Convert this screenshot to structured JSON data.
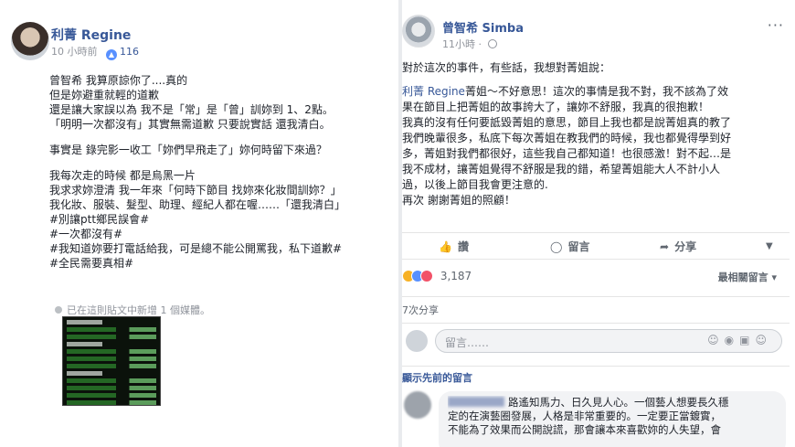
{
  "left_post": {
    "author": "利菁 Regine",
    "time": "10 小時前",
    "separator": "·",
    "like_count": "116",
    "body_lines": [
      "曾智希 我算原諒你了....真的",
      "但是妳避重就輕的道歉",
      "還是讓大家誤以為 我不是「常」是「曾」訓妳到 1、2點。",
      "「明明一次都沒有」其實無需道歉 只要說實話 還我清白。",
      "",
      "事實是 錄完影一收工「妳們早飛走了」妳何時留下來過？",
      "",
      "我每次走的時候 都是烏黑一片",
      "我求求妳澄清 我一年來「何時下節目 找妳來化妝間訓妳？」",
      "我化妝、服裝、髮型、助理、經紀人都在喔……「還我清白」",
      "#別讓ptt鄉民誤會#",
      "#一次都沒有#",
      "#我知道妳要打電話給我，可是總不能公開罵我，私下道歉#",
      "#全民需要真相#"
    ],
    "media_note": "已在這則貼文中新增 1 個媒體。"
  },
  "right_post": {
    "author": "曾智希 Simba",
    "time": "11小時",
    "separator": "·",
    "more": "···",
    "body_intro": "對於這次的事件，有些話，我想對菁姐說：",
    "mention": "利菁 Regine",
    "body_first_rest": "菁姐～不好意思！這次的事情是我不對，我不該為了效",
    "body_lines": [
      "果在節目上把菁姐的故事誇大了，讓妳不舒服，我真的很抱歉！",
      "我真的沒有任何要詆毀菁姐的意思，節目上我也都是說菁姐真的教了",
      "我們晚輩很多，私底下每次菁姐在教我們的時候，我也都覺得學到好",
      "多，菁姐對我們都很好，這些我自己都知道！也很感激！對不起…是",
      "我不成材，讓菁姐覺得不舒服是我的錯，希望菁姐能大人不計小人",
      "過，以後上節目我會更注意的."
    ],
    "body_closing": "再次 謝謝菁姐的照顧！",
    "actions": {
      "like": "讚",
      "comment": "留言",
      "share": "分享"
    },
    "reaction_count": "3,187",
    "sort_label": "最相關留言",
    "shares": "7次分享",
    "comment_placeholder": "留言……",
    "show_previous": "顯示先前的留言",
    "comment_lines": [
      "路遙知馬力、日久見人心。一個藝人想要長久穩",
      "定的在演藝圈發展，人格是非常重要的。一定要正當鍍實，",
      "不能為了效果而公開說謊，那會讓本來喜歡妳的人失望，會"
    ]
  },
  "colors": {
    "link": "#385898",
    "meta": "#90949c",
    "text": "#1d2129",
    "like_blue": "#5890ff"
  },
  "icons": {
    "like": "thumbs-up-icon",
    "comment": "speech-bubble-icon",
    "share": "share-arrow-icon",
    "globe": "globe-icon",
    "camera": "camera-icon",
    "gif": "gif-icon",
    "sticker": "sticker-icon",
    "emoji": "emoji-icon"
  }
}
